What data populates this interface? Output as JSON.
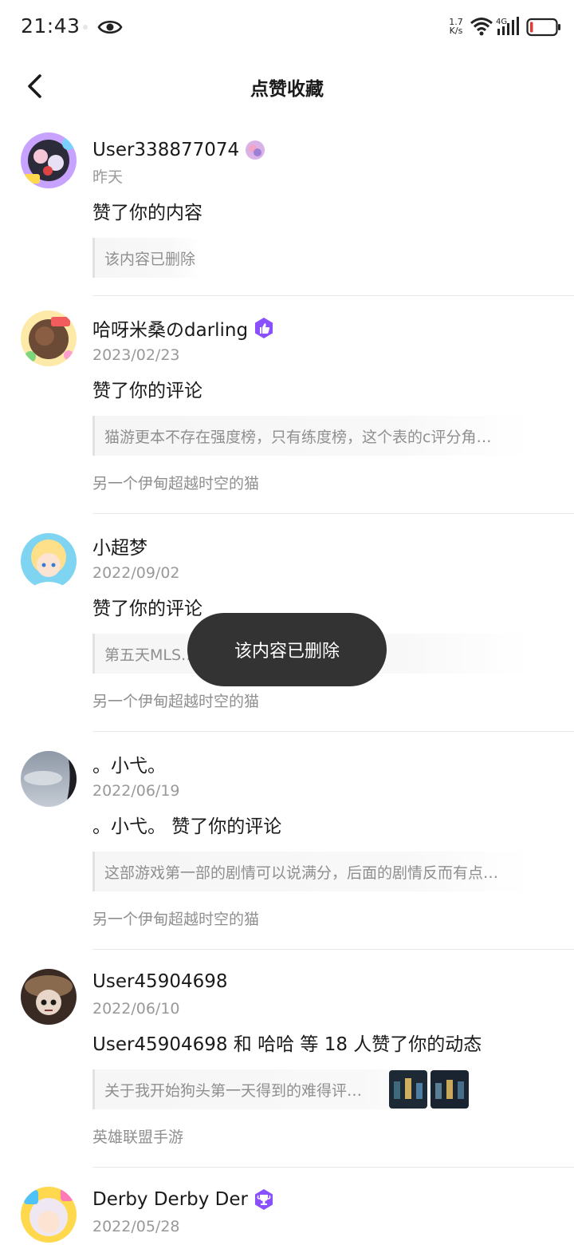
{
  "status_bar": {
    "time": "21:43",
    "network_speed_value": "1.7",
    "network_speed_unit": "K/s",
    "cell_label": "4G",
    "icons": [
      "eye-icon",
      "wifi-icon",
      "cell-signal-icon",
      "battery-icon"
    ]
  },
  "header": {
    "title": "点赞收藏",
    "back_icon": "chevron-left-icon"
  },
  "colors": {
    "text_primary": "#1a1a1a",
    "text_secondary": "#999999",
    "quote_bg": "#f6f6f6",
    "badge_purple": "#8a4fff",
    "toast_bg": "#333333",
    "battery_low": "#e53935"
  },
  "notifications": [
    {
      "username": "User338877074",
      "badge": "avatar-frame-icon",
      "time": "昨天",
      "action": "赞了你的内容",
      "quote": "该内容已删除",
      "source": ""
    },
    {
      "username": "哈呀米桑のdarling",
      "badge": "thumbs-up-badge-icon",
      "time": "2023/02/23",
      "action": "赞了你的评论",
      "quote": "猫游更本不存在强度榜，只有练度榜，这个表的c评分角…",
      "source": "另一个伊甸超越时空的猫"
    },
    {
      "username": "小超梦",
      "badge": "",
      "time": "2022/09/02",
      "action": "赞了你的评论",
      "quote": "第五天MLS…",
      "source": "另一个伊甸超越时空的猫"
    },
    {
      "username": "。小弋。",
      "badge": "",
      "time": "2022/06/19",
      "action": "。小弋。 赞了你的评论",
      "quote": "这部游戏第一部的剧情可以说满分，后面的剧情反而有点…",
      "source": "另一个伊甸超越时空的猫"
    },
    {
      "username": "User45904698",
      "badge": "",
      "time": "2022/06/10",
      "action": "User45904698 和 哈哈 等 18 人赞了你的动态",
      "quote": "关于我开始狗头第一天得到的难得评…",
      "source": "英雄联盟手游"
    },
    {
      "username": "Derby Derby Der",
      "badge": "trophy-badge-icon",
      "time": "2022/05/28",
      "action": "",
      "quote": "",
      "source": ""
    }
  ],
  "toast": {
    "message": "该内容已删除"
  }
}
